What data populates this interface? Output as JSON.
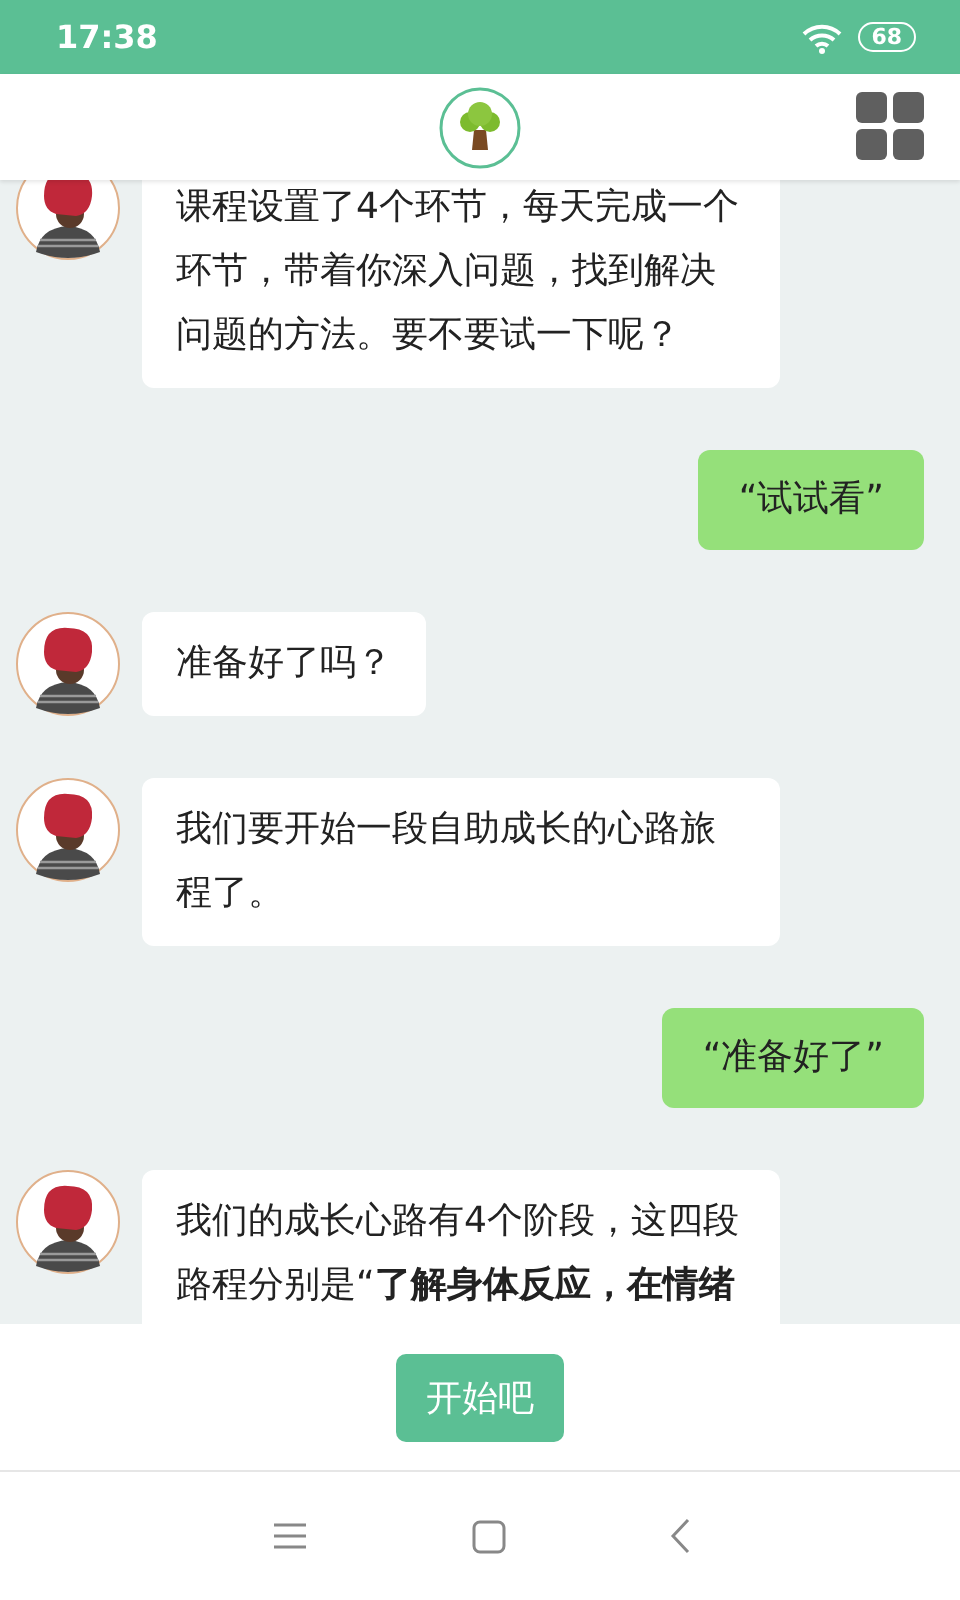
{
  "status_bar": {
    "time": "17:38",
    "battery": "68"
  },
  "messages": [
    {
      "kind": "bot",
      "text": "课程设置了4个环节，每天完成一个环节，带着你深入问题，找到解决问题的方法。要不要试一下呢？"
    },
    {
      "kind": "user",
      "text": "“试试看”"
    },
    {
      "kind": "bot",
      "text": "准备好了吗？"
    },
    {
      "kind": "bot",
      "text": "我们要开始一段自助成长的心路旅程了。"
    },
    {
      "kind": "user",
      "text": "“准备好了”"
    },
    {
      "kind": "bot",
      "text": "我们的成长心路有4个阶段，这四段路程分别是“**了解身体反应，在情绪**"
    }
  ],
  "action_button": "开始吧"
}
